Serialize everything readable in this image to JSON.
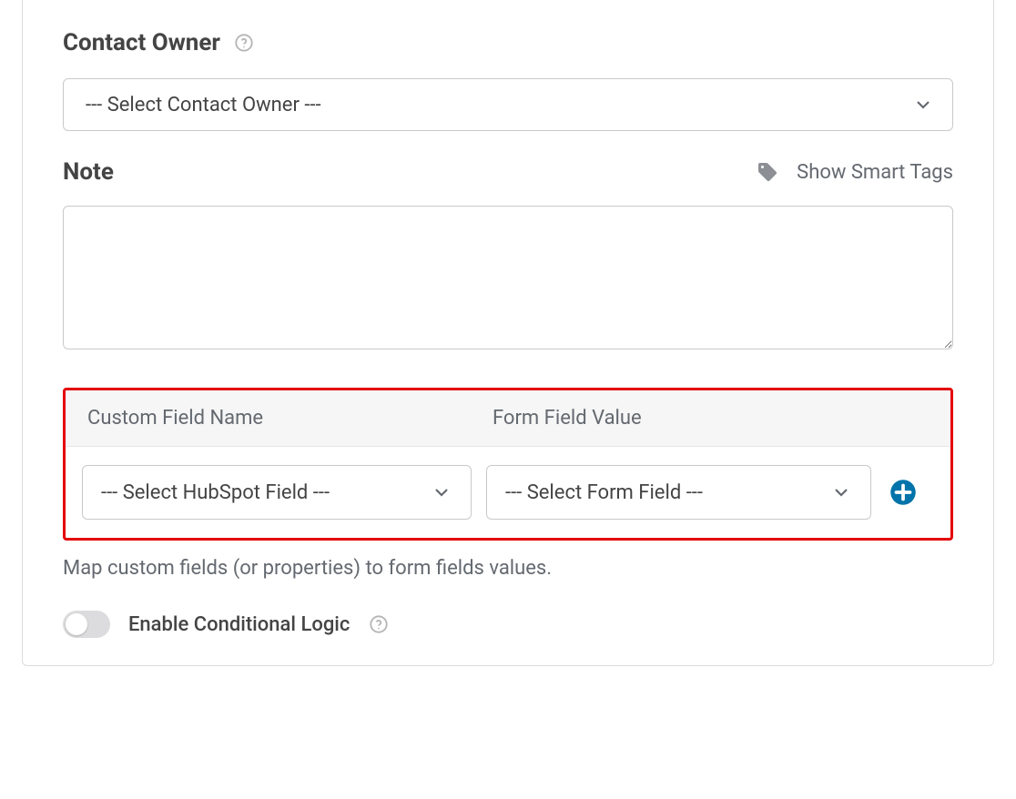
{
  "contact_owner": {
    "label": "Contact Owner",
    "selected": "--- Select Contact Owner ---"
  },
  "note": {
    "label": "Note",
    "smart_tags_label": "Show Smart Tags",
    "value": ""
  },
  "custom_fields": {
    "header_col1": "Custom Field Name",
    "header_col2": "Form Field Value",
    "row": {
      "hubspot_selected": "--- Select HubSpot Field ---",
      "form_selected": "--- Select Form Field ---"
    },
    "hint": "Map custom fields (or properties) to form fields values."
  },
  "conditional": {
    "label": "Enable Conditional Logic",
    "enabled": false
  }
}
